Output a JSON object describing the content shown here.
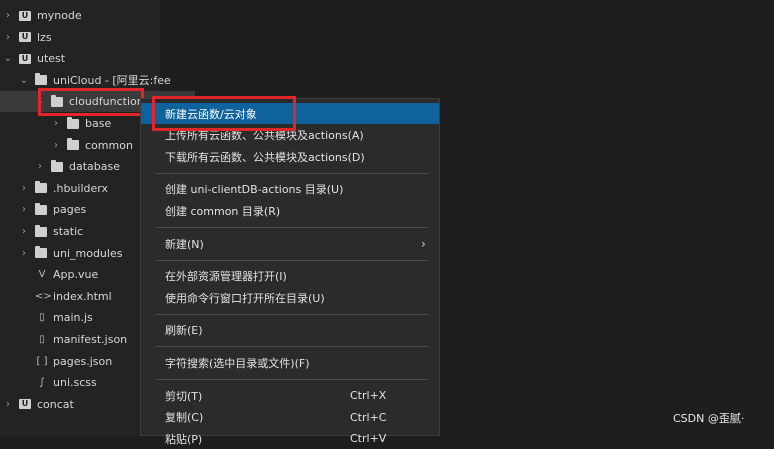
{
  "tree": {
    "items": [
      {
        "label": "mynode",
        "type": "project",
        "indent": 0,
        "chevron": ">"
      },
      {
        "label": "lzs",
        "type": "project",
        "indent": 0,
        "chevron": ">"
      },
      {
        "label": "utest",
        "type": "project",
        "indent": 0,
        "chevron": "v"
      },
      {
        "label": "uniCloud - [阿里云:fee",
        "type": "folder",
        "indent": 1,
        "chevron": "v"
      },
      {
        "label": "cloudfunctions",
        "type": "folder",
        "indent": 2,
        "chevron": "v"
      },
      {
        "label": "base",
        "type": "folder",
        "indent": 3,
        "chevron": ">"
      },
      {
        "label": "common",
        "type": "folder",
        "indent": 3,
        "chevron": ">"
      },
      {
        "label": "database",
        "type": "folder",
        "indent": 2,
        "chevron": ">"
      },
      {
        "label": ".hbuilderx",
        "type": "folder",
        "indent": 1,
        "chevron": ">"
      },
      {
        "label": "pages",
        "type": "folder",
        "indent": 1,
        "chevron": ">"
      },
      {
        "label": "static",
        "type": "folder",
        "indent": 1,
        "chevron": ">"
      },
      {
        "label": "uni_modules",
        "type": "folder",
        "indent": 1,
        "chevron": ">"
      },
      {
        "label": "App.vue",
        "type": "file",
        "icon": "V",
        "indent": 1,
        "chevron": ""
      },
      {
        "label": "index.html",
        "type": "file",
        "icon": "<>",
        "indent": 1,
        "chevron": ""
      },
      {
        "label": "main.js",
        "type": "file",
        "icon": "▯",
        "indent": 1,
        "chevron": ""
      },
      {
        "label": "manifest.json",
        "type": "file",
        "icon": "▯",
        "indent": 1,
        "chevron": ""
      },
      {
        "label": "pages.json",
        "type": "file",
        "icon": "[ ]",
        "indent": 1,
        "chevron": ""
      },
      {
        "label": "uni.scss",
        "type": "file",
        "icon": "∫",
        "indent": 1,
        "chevron": ""
      },
      {
        "label": "concat",
        "type": "project",
        "indent": 0,
        "chevron": ">"
      }
    ]
  },
  "menu": {
    "items": [
      {
        "label": "新建云函数/云对象",
        "shortcut": "",
        "highlight": true
      },
      {
        "label": "上传所有云函数、公共模块及actions(A)",
        "shortcut": ""
      },
      {
        "label": "下载所有云函数、公共模块及actions(D)",
        "shortcut": ""
      },
      {
        "sep": true
      },
      {
        "label": "创建 uni-clientDB-actions 目录(U)",
        "shortcut": ""
      },
      {
        "label": "创建 common 目录(R)",
        "shortcut": ""
      },
      {
        "sep": true
      },
      {
        "label": "新建(N)",
        "shortcut": "",
        "submenu": true
      },
      {
        "sep": true
      },
      {
        "label": "在外部资源管理器打开(I)",
        "shortcut": ""
      },
      {
        "label": "使用命令行窗口打开所在目录(U)",
        "shortcut": ""
      },
      {
        "sep": true
      },
      {
        "label": "刷新(E)",
        "shortcut": ""
      },
      {
        "sep": true
      },
      {
        "label": "字符搜索(选中目录或文件)(F)",
        "shortcut": ""
      },
      {
        "sep": true
      },
      {
        "label": "剪切(T)",
        "shortcut": "Ctrl+X"
      },
      {
        "label": "复制(C)",
        "shortcut": "Ctrl+C"
      },
      {
        "label": "粘贴(P)",
        "shortcut": "Ctrl+V"
      }
    ]
  },
  "watermark": "CSDN @歪腻·",
  "colors": {
    "highlight": "#0e639c",
    "annotation": "#e0262a"
  }
}
